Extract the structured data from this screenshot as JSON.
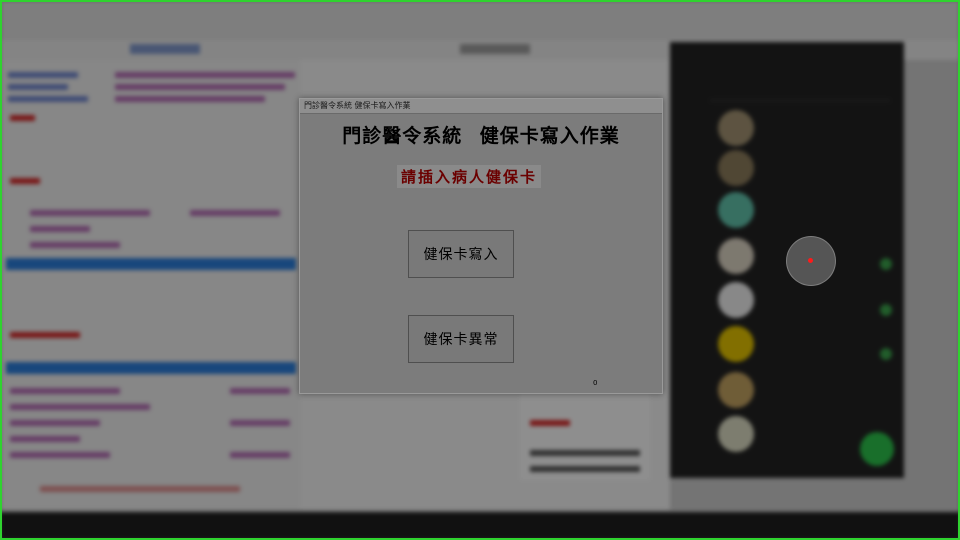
{
  "dialog": {
    "window_title": "門診醫令系統   健保卡寫入作業",
    "heading": "門診醫令系統   健保卡寫入作業",
    "prompt": "請插入病人健保卡",
    "write_button": "健保卡寫入",
    "error_button": "健保卡異常",
    "counter": "0"
  },
  "colors": {
    "frame_border": "#2fd32f",
    "prompt_text": "#6b0000",
    "cursor_dot": "#ff1a1a"
  }
}
